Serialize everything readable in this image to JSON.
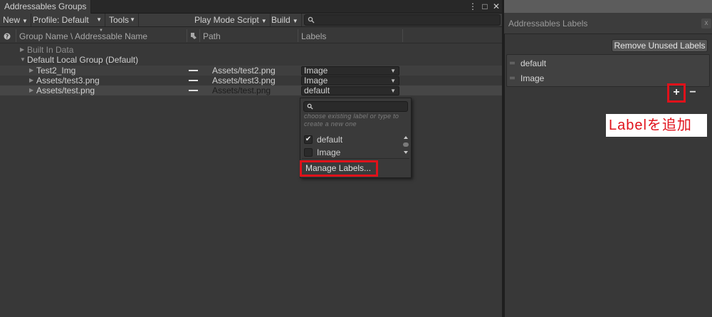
{
  "groups_window": {
    "tab_title": "Addressables Groups",
    "controls": [
      "⋮",
      "□",
      "✕"
    ],
    "toolbar": {
      "new_label": "New",
      "profile_label": "Profile: Default",
      "tools_label": "Tools",
      "play_mode_label": "Play Mode Script",
      "build_label": "Build",
      "search_placeholder": ""
    },
    "columns": {
      "group_name": "Group Name \\ Addressable Name",
      "path": "Path",
      "labels": "Labels"
    },
    "rows": [
      {
        "name": "Built In Data",
        "path": "",
        "label": ""
      },
      {
        "name": "Default Local Group (Default)",
        "path": "",
        "label": ""
      },
      {
        "name": "Test2_Img",
        "path": "Assets/test2.png",
        "label": "Image"
      },
      {
        "name": "Assets/test3.png",
        "path": "Assets/test3.png",
        "label": "Image"
      },
      {
        "name": "Assets/test.png",
        "path": "Assets/test.png",
        "label": "default"
      }
    ],
    "popup": {
      "hint": "choose existing label or type to create a new one",
      "items": [
        {
          "label": "default",
          "checked": true
        },
        {
          "label": "Image",
          "checked": false
        }
      ],
      "manage_label": "Manage Labels..."
    }
  },
  "labels_window": {
    "title": "Addressables Labels",
    "close": "x",
    "remove_button": "Remove Unused Labels",
    "labels": [
      "default",
      "Image"
    ],
    "add_symbol": "+",
    "remove_symbol": "−",
    "annotation": "Labelを追加"
  },
  "colors": {
    "highlight": "#e0111a",
    "panel": "#383838"
  }
}
